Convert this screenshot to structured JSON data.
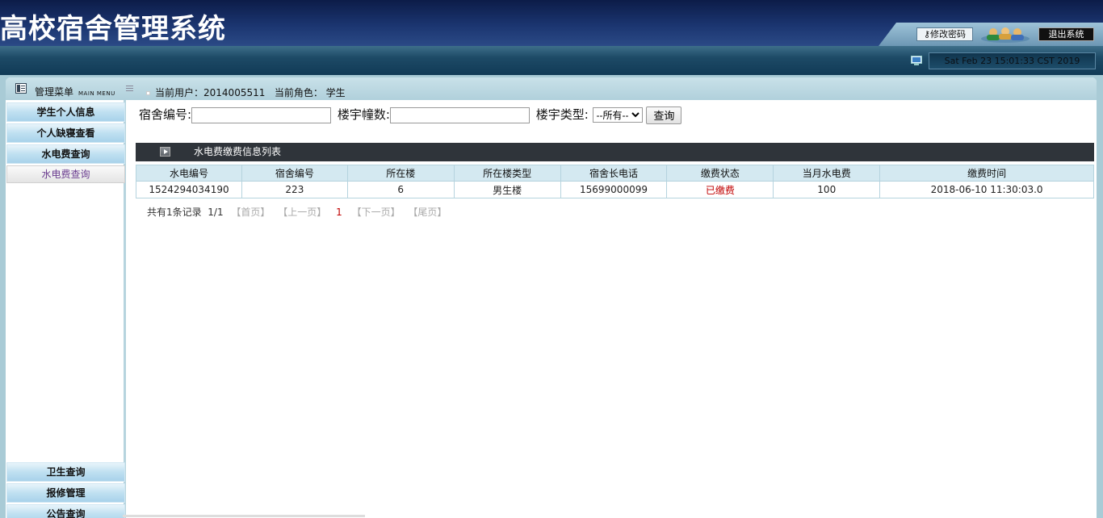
{
  "app": {
    "title": "高校宿舍管理系统"
  },
  "header": {
    "change_password": "修改密码",
    "logout": "退出系统",
    "datetime": "Sat Feb 23 15:01:33 CST 2019"
  },
  "topbar": {
    "menu_title": "管理菜单",
    "menu_title_en": "MAIN MENU",
    "user_label": "当前用户：",
    "user_value": "2014005511",
    "role_label": "当前角色：",
    "role_value": "学生"
  },
  "sidebar": {
    "items": [
      {
        "label": "学生个人信息"
      },
      {
        "label": "个人缺寝查看"
      },
      {
        "label": "水电费查询"
      },
      {
        "label": "水电费查询"
      },
      {
        "label": "卫生查询"
      },
      {
        "label": "报修管理"
      },
      {
        "label": "公告查询"
      }
    ]
  },
  "search": {
    "dorm_no_label": "宿舍编号:",
    "dorm_no_value": "",
    "building_label": "楼宇幢数:",
    "building_value": "",
    "type_label": "楼宇类型:",
    "type_selected": "--所有--",
    "query_button": "查询"
  },
  "list": {
    "title": "水电费缴费信息列表",
    "columns": [
      "水电编号",
      "宿舍编号",
      "所在楼",
      "所在楼类型",
      "宿舍长电话",
      "缴费状态",
      "当月水电费",
      "缴费时间"
    ],
    "rows": [
      [
        "1524294034190",
        "223",
        "6",
        "男生楼",
        "15699000099",
        "已缴费",
        "100",
        "2018-06-10 11:30:03.0"
      ]
    ]
  },
  "pager": {
    "summary": "共有1条记录",
    "pages": "1/1",
    "first": "【首页】",
    "prev": "【上一页】",
    "current": "1",
    "next": "【下一页】",
    "last": "【尾页】"
  },
  "colors": {
    "header_dark": "#0c1c48",
    "status_paid": "#c00000",
    "table_header": "#d4e9f1",
    "list_header": "#2f343a"
  }
}
